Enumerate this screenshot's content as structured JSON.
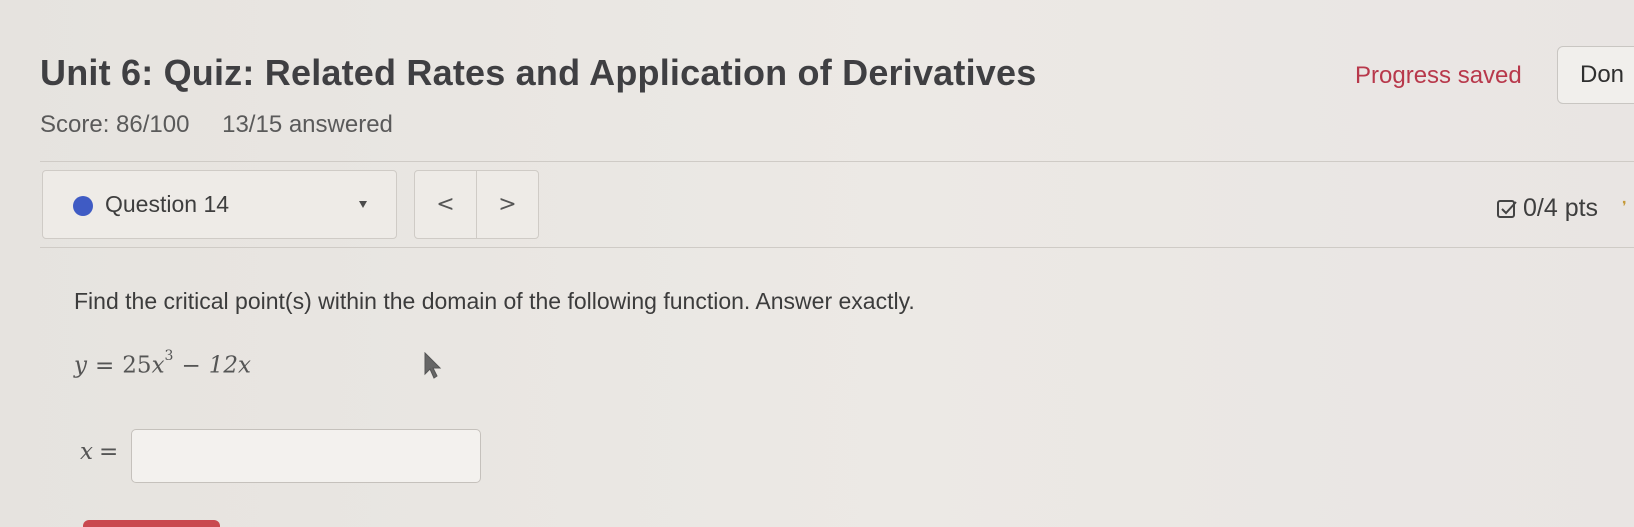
{
  "header": {
    "title": "Unit 6: Quiz: Related Rates and Application of Derivatives",
    "progress_status": "Progress saved",
    "done_label": "Don"
  },
  "score": {
    "score_text": "Score: 86/100",
    "answered_text": "13/15 answered"
  },
  "question_nav": {
    "selected_question": "Question 14",
    "prev_glyph": "<",
    "next_glyph": ">",
    "points": "0/4 pts"
  },
  "question": {
    "prompt": "Find the critical point(s) within the domain of the following function. Answer exactly.",
    "equation": {
      "lhs": "y",
      "equals": "=",
      "term1_coef": "25",
      "term1_var": "x",
      "term1_exp": "3",
      "minus": "−",
      "term2": "12x"
    },
    "answer_label_var": "x",
    "answer_label_eq": "=",
    "answer_value": ""
  },
  "colors": {
    "status_dot": "#3f5bc4",
    "progress_saved": "#b8384b",
    "submit_button": "#c9494f"
  },
  "icons": {
    "status": "status-dot",
    "dropdown": "caret-down-icon",
    "points": "check-square-icon",
    "cursor": "mouse-pointer-icon"
  }
}
